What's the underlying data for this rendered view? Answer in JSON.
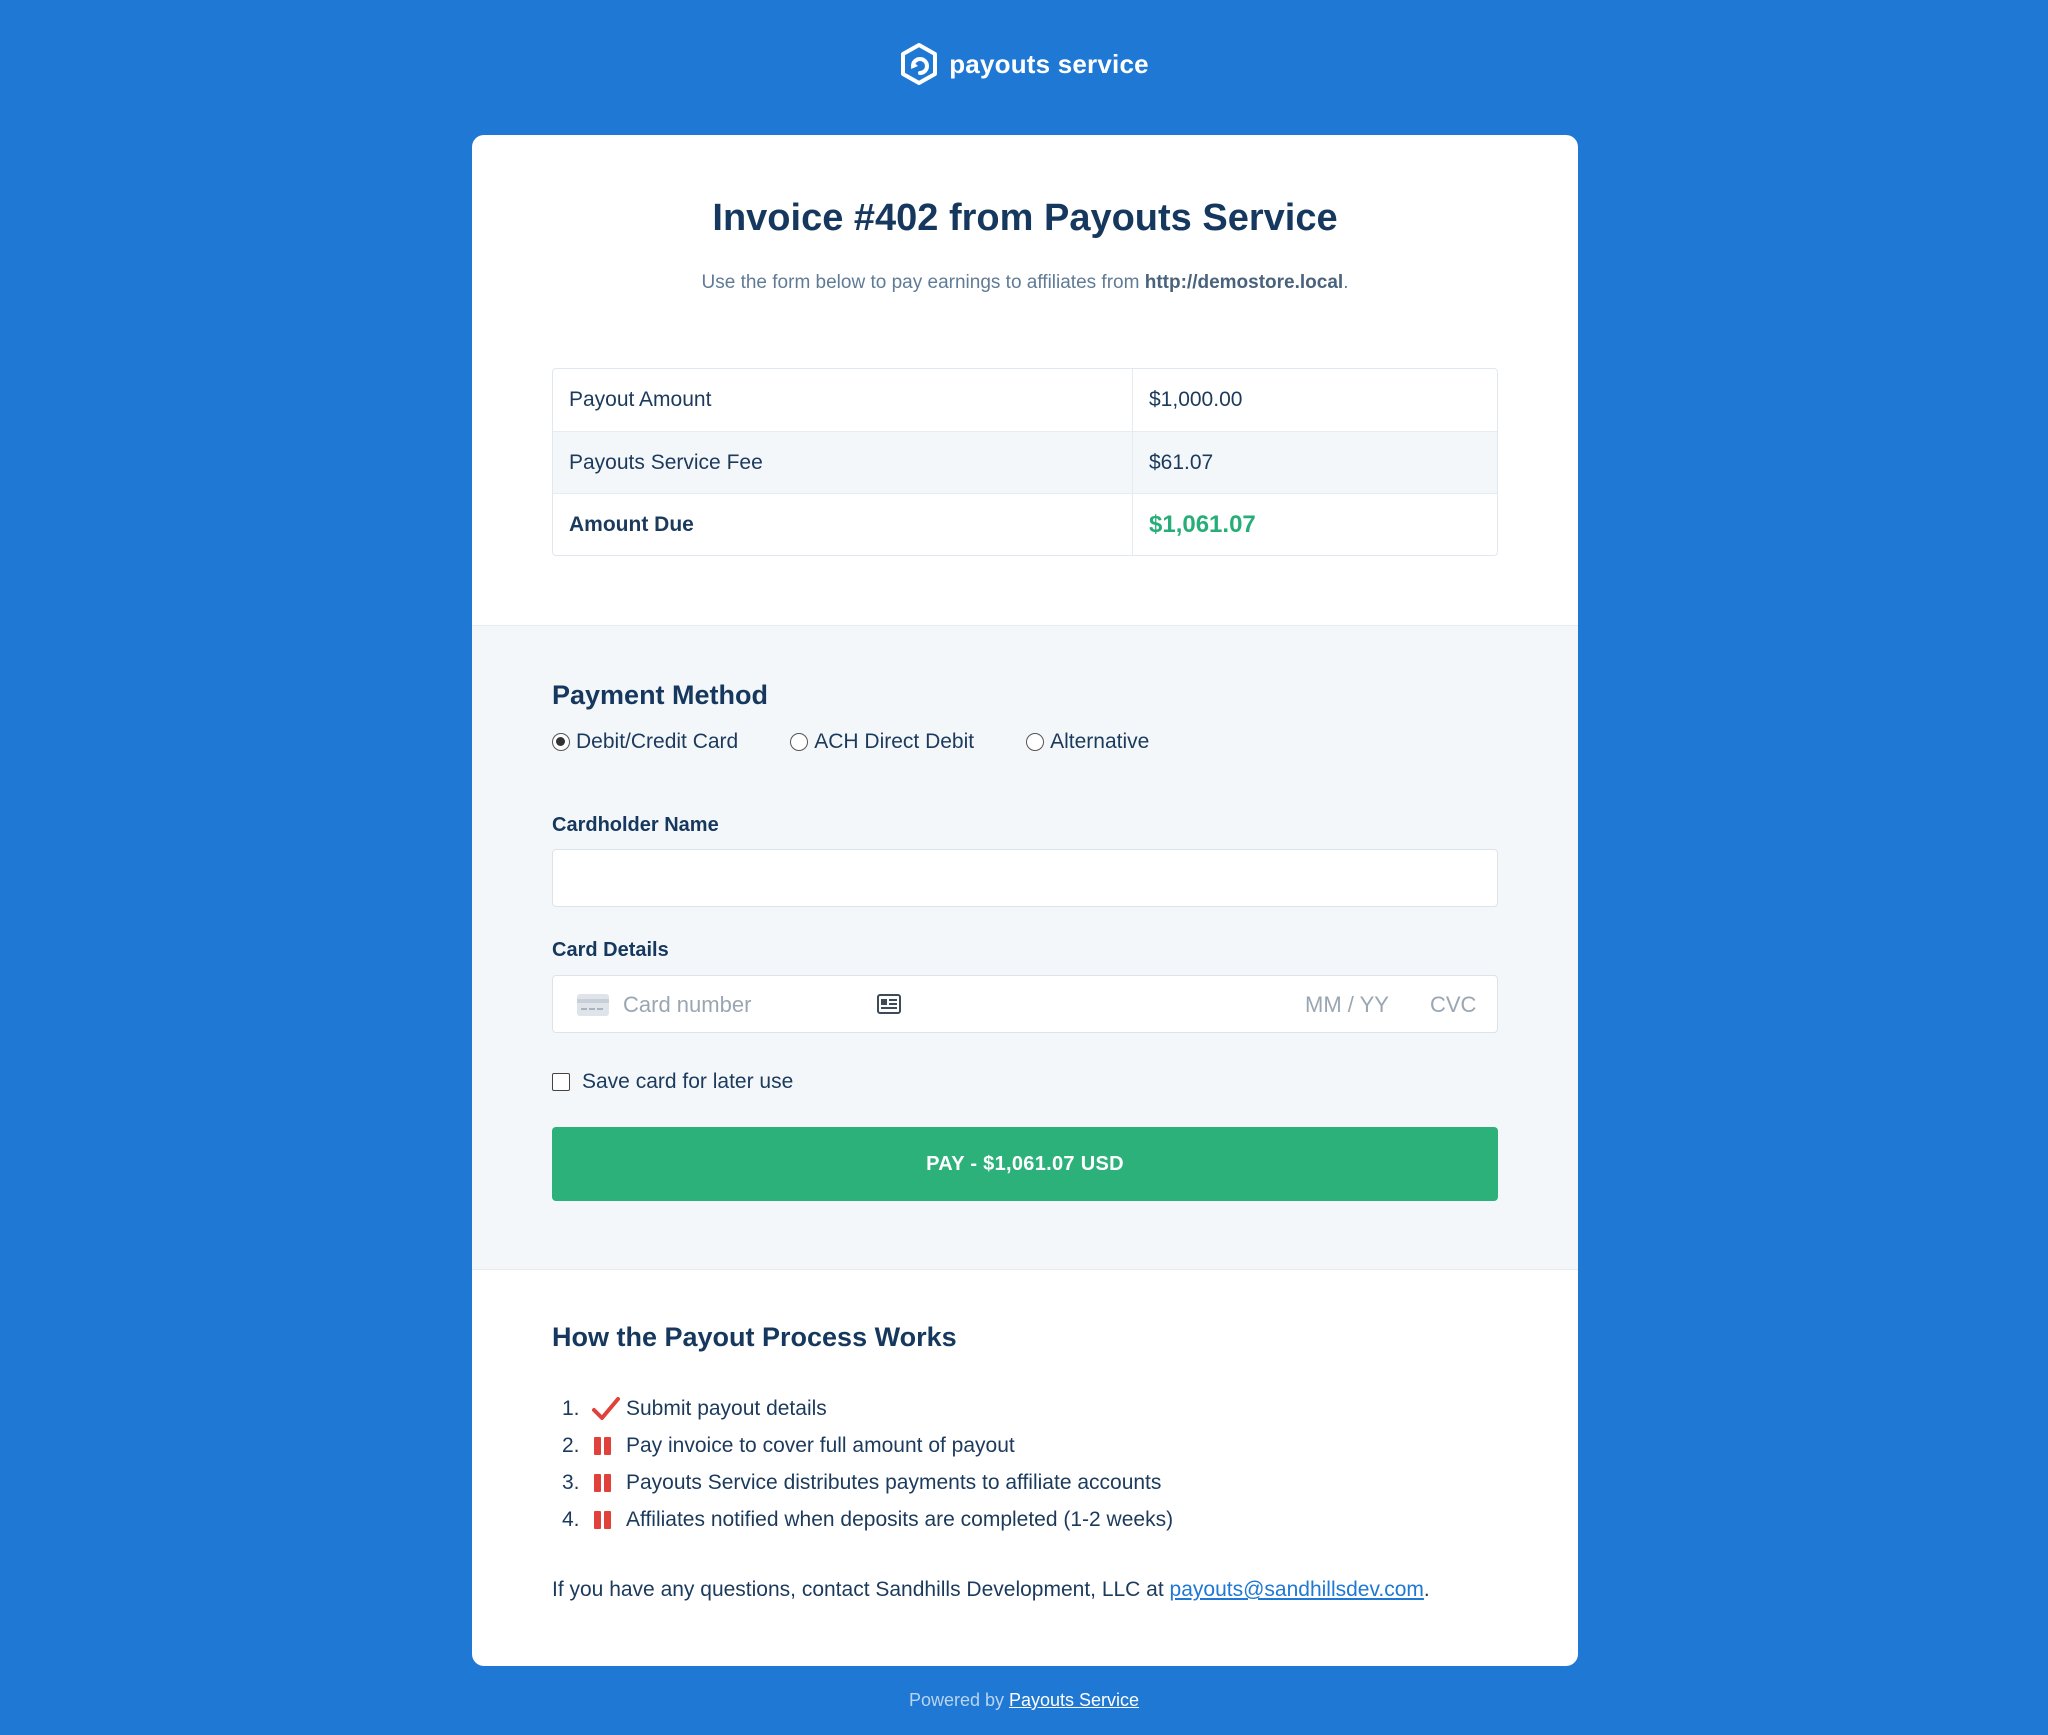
{
  "brand": {
    "name": "payouts service",
    "logo_icon": "hexagon-logo-icon"
  },
  "invoice": {
    "title": "Invoice #402 from Payouts Service",
    "subtitle_prefix": "Use the form below to pay earnings to affiliates from ",
    "subtitle_site": "http://demostore.local",
    "subtitle_suffix": ".",
    "rows": [
      {
        "label": "Payout Amount",
        "value": "$1,000.00"
      },
      {
        "label": "Payouts Service Fee",
        "value": "$61.07"
      },
      {
        "label": "Amount Due",
        "value": "$1,061.07"
      }
    ],
    "due_color": "#27ae78"
  },
  "payment": {
    "title": "Payment Method",
    "options": [
      {
        "label": "Debit/Credit Card",
        "selected": true
      },
      {
        "label": "ACH Direct Debit",
        "selected": false
      },
      {
        "label": "Alternative",
        "selected": false
      }
    ],
    "cardholder_label": "Cardholder Name",
    "cardholder_value": "",
    "card_details_label": "Card Details",
    "card_number_placeholder": "Card number",
    "expiry_placeholder": "MM / YY",
    "cvc_placeholder": "CVC",
    "save_card_label": "Save card for later use",
    "pay_button": "PAY - $1,061.07 USD",
    "pay_color": "#2db17a"
  },
  "process": {
    "title": "How the Payout Process Works",
    "steps": [
      {
        "num": "1.",
        "text": "Submit payout details",
        "icon": "checkmark-icon"
      },
      {
        "num": "2.",
        "text": "Pay invoice to cover full amount of payout",
        "icon": "pause-icon"
      },
      {
        "num": "3.",
        "text": "Payouts Service distributes payments to affiliate accounts",
        "icon": "pause-icon"
      },
      {
        "num": "4.",
        "text": "Affiliates notified when deposits are completed (1-2 weeks)",
        "icon": "pause-icon"
      }
    ],
    "contact_prefix": "If you have any questions, contact Sandhills Development, LLC at ",
    "contact_email": "payouts@sandhillsdev.com",
    "contact_suffix": "."
  },
  "footer": {
    "prefix": "Powered by ",
    "link": "Payouts Service"
  },
  "colors": {
    "background": "#1e78d4",
    "heading": "#16385e"
  }
}
